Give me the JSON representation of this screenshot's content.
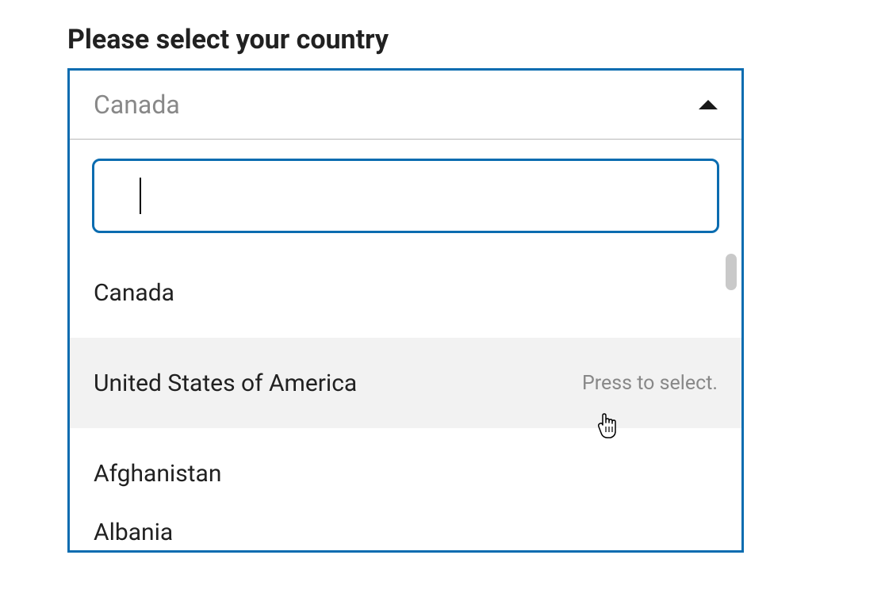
{
  "label": "Please select your country",
  "selected_value": "Canada",
  "search_value": "",
  "hover_hint": "Press to select.",
  "options": [
    {
      "label": "Canada",
      "hovered": false
    },
    {
      "label": "United States of America",
      "hovered": true
    },
    {
      "label": "Afghanistan",
      "hovered": false
    },
    {
      "label": "Albania",
      "hovered": false
    }
  ],
  "colors": {
    "accent": "#0a6cb0",
    "text": "#212121",
    "placeholder": "#888888",
    "hover_bg": "#f2f2f2"
  }
}
